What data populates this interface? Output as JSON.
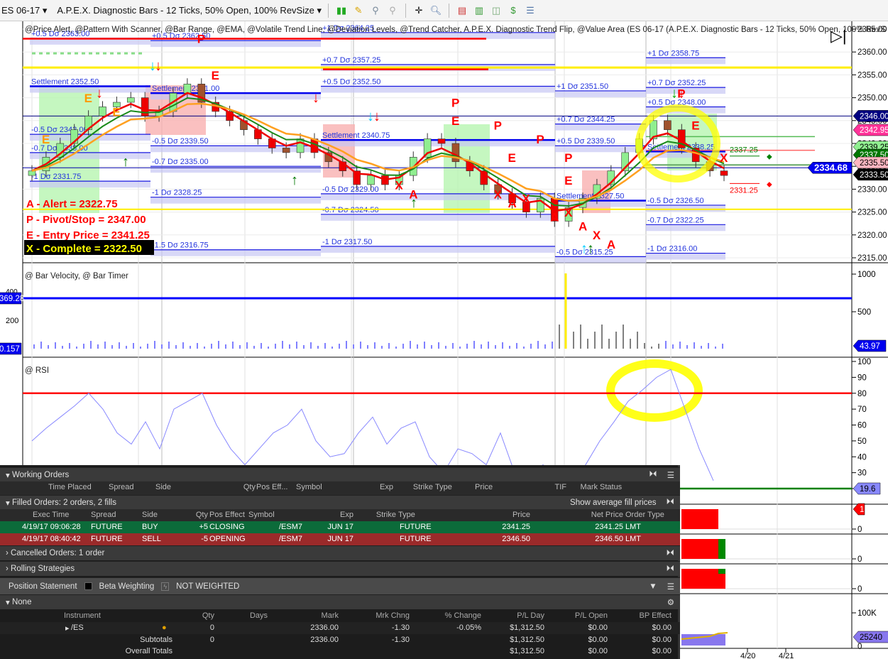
{
  "toolbar": {
    "symbol": "ES 06-17",
    "chart_style": "A.P.E.X. Diagnostic Bars - 12 Ticks, 50% Open, 100% RevSize"
  },
  "chart": {
    "study_title": "@Price Alert, @Pattern With Scanner, @Bar Range, @EMA, @Volatile Trend Line, @Deviation Levels, @Trend Catcher, A.P.E.X. Diagnostic Trend Flip, @Value Area (ES 06-17 (A.P.E.X. Diagnostic Bars - 12 Ticks, 50% Open, 100% RevS",
    "price_axis": [
      "2365.00",
      "2360.00",
      "2355.00",
      "2350.00",
      "2345.00",
      "2340.00",
      "2335.00",
      "2330.00",
      "2325.00",
      "2320.00",
      "2315.00"
    ],
    "price_ticks": [
      2365,
      2360,
      2355,
      2350,
      2345,
      2340,
      2335,
      2330,
      2325,
      2320,
      2315
    ],
    "price_tags": [
      {
        "text": "2346.00",
        "price": 2346.0,
        "bg": "#000080",
        "fg": "#fff"
      },
      {
        "text": "2342.95",
        "price": 2342.95,
        "bg": "#ff3399",
        "fg": "#fff"
      },
      {
        "text": "2339.25",
        "price": 2339.25,
        "bg": "#90ee90",
        "fg": "#000"
      },
      {
        "text": "2337.50",
        "price": 2337.5,
        "bg": "#007700",
        "fg": "#fff"
      },
      {
        "text": "2335.50",
        "price": 2335.5,
        "bg": "#ffb6c1",
        "fg": "#000"
      },
      {
        "text": "2333.50",
        "price": 2333.5,
        "bg": "#000",
        "fg": "#fff"
      }
    ],
    "last_price": "2334.68",
    "side_labels": [
      {
        "text": "2337.25",
        "price": 2337.25,
        "color": "#008000"
      },
      {
        "text": "2331.25",
        "price": 2331.25,
        "color": "#ff0000"
      }
    ],
    "legend": {
      "alert": "A - Alert = 2322.75",
      "pivot": "P - Pivot/Stop = 2347.00",
      "entry": "E - Entry Price = 2341.25",
      "complete": "X - Complete = 2322.50"
    },
    "deviation_segments": [
      {
        "levels": [
          {
            "t": "+0.5 Dσ 2363.00",
            "p": 2363
          },
          {
            "t": "Settlement 2352.50",
            "p": 2352.5
          },
          {
            "t": "-0.5 Dσ 2342.00",
            "p": 2342
          },
          {
            "t": "-0.7 Dσ 2338.00",
            "p": 2338
          },
          {
            "t": "-1 Dσ 2331.75",
            "p": 2331.75
          }
        ]
      },
      {
        "levels": [
          {
            "t": "+0.5 Dσ 2362.50",
            "p": 2362.5
          },
          {
            "t": "Settlement 2351.00",
            "p": 2351
          },
          {
            "t": "-0.5 Dσ 2339.50",
            "p": 2339.5
          },
          {
            "t": "-0.7 Dσ 2335.00",
            "p": 2335
          },
          {
            "t": "-1 Dσ 2328.25",
            "p": 2328.25
          },
          {
            "t": "-1.5 Dσ 2316.75",
            "p": 2316.75
          }
        ]
      },
      {
        "levels": [
          {
            "t": "+1 Dσ 2364.25",
            "p": 2364.25
          },
          {
            "t": "+0.7 Dσ 2357.25",
            "p": 2357.25
          },
          {
            "t": "+0.5 Dσ 2352.50",
            "p": 2352.5
          },
          {
            "t": "Settlement 2340.75",
            "p": 2340.75
          },
          {
            "t": "-0.5 Dσ 2329.00",
            "p": 2329
          },
          {
            "t": "-0.7 Dσ 2324.50",
            "p": 2324.5
          },
          {
            "t": "-1 Dσ 2317.50",
            "p": 2317.5
          }
        ]
      },
      {
        "levels": [
          {
            "t": "+1 Dσ 2351.50",
            "p": 2351.5
          },
          {
            "t": "+0.7 Dσ 2344.25",
            "p": 2344.25
          },
          {
            "t": "+0.5 Dσ 2339.50",
            "p": 2339.5
          },
          {
            "t": "Settlement 2327.50",
            "p": 2327.5
          },
          {
            "t": "-0.5 Dσ 2315.25",
            "p": 2315.25
          }
        ]
      },
      {
        "levels": [
          {
            "t": "+1 Dσ 2358.75",
            "p": 2358.75
          },
          {
            "t": "+0.7 Dσ 2352.25",
            "p": 2352.25
          },
          {
            "t": "+0.5 Dσ 2348.00",
            "p": 2348
          },
          {
            "t": "Settlement 2338.25",
            "p": 2338.25
          },
          {
            "t": "-0.5 Dσ 2326.50",
            "p": 2326.5
          },
          {
            "t": "-0.7 Dσ 2322.25",
            "p": 2322.25
          },
          {
            "t": "-1 Dσ 2316.00",
            "p": 2316
          }
        ]
      }
    ],
    "closes": [
      2334,
      2337,
      2340,
      2343,
      2346,
      2348,
      2349,
      2350,
      2346,
      2347,
      2351,
      2353,
      2349,
      2347,
      2345,
      2343,
      2341,
      2339,
      2338,
      2341,
      2338,
      2336,
      2334,
      2331,
      2333,
      2331,
      2333,
      2337,
      2341,
      2340,
      2336,
      2334,
      2331,
      2329,
      2327,
      2325,
      2328,
      2323,
      2326,
      2328,
      2331,
      2334,
      2338,
      2341,
      2345,
      2343,
      2339,
      2336,
      2334,
      2333
    ],
    "markers": [
      {
        "t": "P",
        "i": 12,
        "p": 2362
      },
      {
        "t": "E",
        "i": 13,
        "p": 2354
      },
      {
        "t": "E",
        "i": 4,
        "p": 2349
      },
      {
        "t": "E",
        "i": 6,
        "p": 2346
      },
      {
        "t": "E",
        "i": 1,
        "p": 2340
      },
      {
        "t": "P",
        "i": 30,
        "p": 2348
      },
      {
        "t": "E",
        "i": 30,
        "p": 2344
      },
      {
        "t": "P",
        "i": 33,
        "p": 2343
      },
      {
        "t": "P",
        "i": 36,
        "p": 2340
      },
      {
        "t": "E",
        "i": 34,
        "p": 2336
      },
      {
        "t": "P",
        "i": 38,
        "p": 2336
      },
      {
        "t": "E",
        "i": 38,
        "p": 2331
      },
      {
        "t": "X",
        "i": 26,
        "p": 2330
      },
      {
        "t": "A",
        "i": 27,
        "p": 2328
      },
      {
        "t": "X",
        "i": 33,
        "p": 2328
      },
      {
        "t": "A",
        "i": 34,
        "p": 2326
      },
      {
        "t": "X",
        "i": 35,
        "p": 2327
      },
      {
        "t": "A",
        "i": 37,
        "p": 2323
      },
      {
        "t": "X",
        "i": 38,
        "p": 2324
      },
      {
        "t": "A",
        "i": 39,
        "p": 2321
      },
      {
        "t": "X",
        "i": 40,
        "p": 2319
      },
      {
        "t": "A",
        "i": 41,
        "p": 2317
      },
      {
        "t": "P",
        "i": 46,
        "p": 2350
      },
      {
        "t": "E",
        "i": 47,
        "p": 2343
      },
      {
        "t": "X",
        "i": 49,
        "p": 2336
      }
    ],
    "velocity": {
      "title": "@ Bar Velocity, @ Bar Timer",
      "axis": [
        "1000",
        "500"
      ],
      "left_axis": [
        "400",
        "200"
      ],
      "tag_left_top": "369.28",
      "tag_left_bottom": "0.157",
      "tag_right": "43.97"
    },
    "rsi": {
      "title": "@ RSI",
      "axis": [
        "100",
        "90",
        "80",
        "70",
        "60",
        "50",
        "40",
        "30",
        "20"
      ],
      "tag": "19.6",
      "values": [
        50,
        58,
        65,
        72,
        80,
        70,
        55,
        48,
        62,
        45,
        70,
        75,
        80,
        60,
        45,
        35,
        45,
        55,
        60,
        70,
        50,
        40,
        42,
        55,
        65,
        48,
        58,
        62,
        40,
        30,
        45,
        42,
        35,
        55,
        30,
        28,
        35,
        25,
        22,
        35,
        50,
        62,
        75,
        82,
        90,
        95,
        70,
        45,
        25
      ]
    },
    "sub_panels": {
      "zero": "0",
      "tag_one": "1",
      "vol_axis": "100K",
      "vol_tag": "25240",
      "dates": [
        "4/20",
        "4/21"
      ]
    }
  },
  "orders": {
    "working": {
      "title": "Working Orders",
      "cols": [
        "Time Placed",
        "Spread",
        "Side",
        "Qty",
        "Pos Eff...",
        "Symbol",
        "Exp",
        "Strike",
        "Type",
        "Price",
        "TIF",
        "Mark",
        "Status"
      ]
    },
    "filled": {
      "title": "Filled Orders: 2 orders, 2 fills",
      "avg_btn": "Show average fill prices",
      "cols": [
        "Exec Time",
        "Spread",
        "Side",
        "Qty",
        "Pos Effect",
        "Symbol",
        "Exp",
        "Strike",
        "Type",
        "Price",
        "Net Price",
        "Order Type"
      ],
      "rows": [
        {
          "time": "4/19/17 09:06:28",
          "spread": "FUTURE",
          "side": "BUY",
          "qty": "+5",
          "pos": "CLOSING",
          "symbol": "/ESM7",
          "exp": "JUN 17",
          "type": "FUTURE",
          "price": "2341.25",
          "net": "2341.25",
          "otype": "LMT"
        },
        {
          "time": "4/19/17 08:40:42",
          "spread": "FUTURE",
          "side": "SELL",
          "qty": "-5",
          "pos": "OPENING",
          "symbol": "/ESM7",
          "exp": "JUN 17",
          "type": "FUTURE",
          "price": "2346.50",
          "net": "2346.50",
          "otype": "LMT"
        }
      ]
    },
    "cancelled": "Cancelled Orders: 1 order",
    "rolling": "Rolling Strategies"
  },
  "position": {
    "title": "Position Statement",
    "beta": "Beta Weighting",
    "weight": "NOT WEIGHTED",
    "group": "None",
    "cols": [
      "Instrument",
      "Qty",
      "Days",
      "Mark",
      "Mrk Chng",
      "% Change",
      "P/L Day",
      "P/L Open",
      "BP Effect"
    ],
    "es": {
      "inst": "/ES",
      "qty": "0",
      "mark": "2336.00",
      "chg": "-1.30",
      "pct": "-0.05%",
      "pld": "$1,312.50",
      "plo": "$0.00",
      "bp": "$0.00"
    },
    "sub": {
      "label": "Subtotals",
      "qty": "0",
      "mark": "2336.00",
      "chg": "-1.30",
      "pld": "$1,312.50",
      "plo": "$0.00",
      "bp": "$0.00"
    },
    "total": {
      "label": "Overall Totals",
      "pld": "$1,312.50",
      "plo": "$0.00",
      "bp": "$0.00"
    }
  }
}
